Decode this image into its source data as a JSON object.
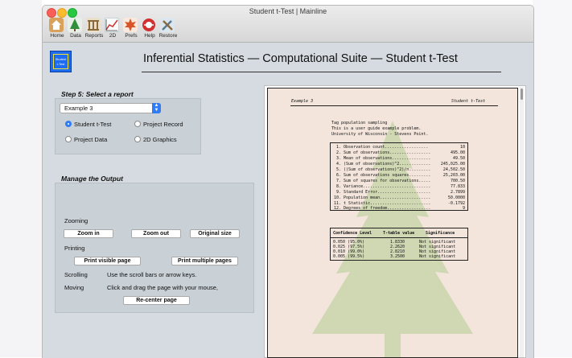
{
  "window": {
    "title": "Student t-Test | Mainline"
  },
  "toolbar": {
    "items": [
      {
        "label": "Home",
        "icon": "home-icon",
        "color": "#c97b3a"
      },
      {
        "label": "Data",
        "icon": "tree-icon",
        "color": "#2f8f3a"
      },
      {
        "label": "Reports",
        "icon": "columns-icon",
        "color": "#b08a4a"
      },
      {
        "label": "2D",
        "icon": "chart-icon",
        "color": "#3a6fd0"
      },
      {
        "label": "Prefs",
        "icon": "leaf-icon",
        "color": "#d8552a"
      },
      {
        "label": "Help",
        "icon": "lifebuoy-icon",
        "color": "#d23030"
      },
      {
        "label": "Restore",
        "icon": "tools-icon",
        "color": "#5a7890"
      }
    ]
  },
  "logo": {
    "text": "Student t-Test"
  },
  "header": {
    "title": "Inferential Statistics — Computational Suite — Student t-Test"
  },
  "report_select": {
    "section_title": "Step 5: Select a report",
    "selected": "Example 3",
    "options": [
      {
        "label": "Student t-Test",
        "selected": true
      },
      {
        "label": "Project Record",
        "selected": false
      },
      {
        "label": "Project Data",
        "selected": false
      },
      {
        "label": "2D Graphics",
        "selected": false
      }
    ]
  },
  "output": {
    "section_title": "Manage the Output",
    "zooming_label": "Zooming",
    "zoom_in": "Zoom in",
    "zoom_out": "Zoom out",
    "original_size": "Original size",
    "printing_label": "Printing",
    "print_visible": "Print visible page",
    "print_multiple": "Print multiple pages",
    "scrolling_label": "Scrolling",
    "scrolling_text": "Use the scroll bars or arrow keys.",
    "moving_label": "Moving",
    "moving_text": "Click and drag the page with your mouse,",
    "recenter": "Re-center page"
  },
  "report": {
    "header_left": "Example 3",
    "header_right": "Student t-Test",
    "intro": [
      "Tag population sampling",
      "This is a user guide example problem.",
      "University of Wisconsin - Stevens Point."
    ],
    "stats": [
      {
        "label": " 1. Observation count..................",
        "value": "10"
      },
      {
        "label": " 2. Sum of observations.................",
        "value": "495.00"
      },
      {
        "label": " 3. Mean of observations................",
        "value": "49.50"
      },
      {
        "label": " 4. (Sum of observations)^2.............",
        "value": "245,025.00"
      },
      {
        "label": " 5. ((Sum of observations)^2)/n.........",
        "value": "24,502.50"
      },
      {
        "label": " 6. Sum of observations squares.........",
        "value": "25,203.00"
      },
      {
        "label": " 7. Sum of squares for observations.....",
        "value": "700.50"
      },
      {
        "label": " 8. Variance............................",
        "value": "77.833"
      },
      {
        "label": " 9. Standard Error......................",
        "value": "2.7899"
      },
      {
        "label": "10. Population mean.....................",
        "value": "50.0000"
      },
      {
        "label": "11. t Statistic.........................",
        "value": "-0.1792"
      },
      {
        "label": "12. Degrees of freedom..................",
        "value": "9"
      }
    ],
    "conf_headers": [
      "Confidence Level",
      "T-table value",
      "Significance"
    ],
    "conf_rows": [
      [
        "0.050 (95.0%)",
        "1.8330",
        "Not significant"
      ],
      [
        "0.025 (97.5%)",
        "2.2620",
        "Not significant"
      ],
      [
        "0.010 (99.0%)",
        "2.8210",
        "Not significant"
      ],
      [
        "0.005 (99.5%)",
        "3.2500",
        "Not significant"
      ]
    ]
  }
}
